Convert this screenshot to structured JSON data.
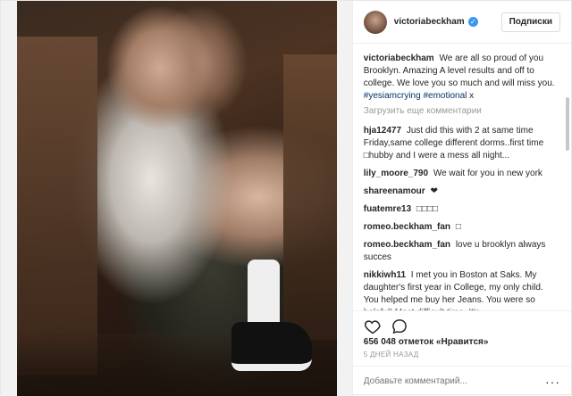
{
  "post": {
    "username": "victoriabeckham",
    "follow_label": "Подписки",
    "caption_user": "victoriabeckham",
    "caption_text": "We are all so proud of you Brooklyn. Amazing A level results and off to college. We love you so much and will miss you.",
    "caption_tags": [
      "#yesiamcrying",
      "#emotional"
    ],
    "caption_tail": "x",
    "load_more": "Загрузить еще комментарии",
    "likes": "656 048 отметок «Нравится»",
    "time": "5 ДНЕЙ НАЗАД",
    "add_comment_placeholder": "Добавьте комментарий...",
    "more_icon": "···"
  },
  "comments": [
    {
      "user": "hja12477",
      "text": "Just did this with 2 at same time Friday,same college different dorms..first time □hubby and I were a mess all night..."
    },
    {
      "user": "lily_moore_790",
      "text": "We wait for you in new york"
    },
    {
      "user": "shareenamour",
      "text": "❤"
    },
    {
      "user": "fuatemre13",
      "text": "□□□□"
    },
    {
      "user": "romeo.beckham_fan",
      "text": "□"
    },
    {
      "user": "romeo.beckham_fan",
      "text": "love u brooklyn always succes"
    },
    {
      "user": "nikkiwh11",
      "text": "I met you in Boston at Saks. My daughter's first year in College, my only child. You helped me buy her Jeans. You were so helpful! Most difficult time. It's..."
    }
  ],
  "colors": {
    "verified": "#3897f0",
    "link": "#003569",
    "muted": "#999999"
  },
  "icons": {
    "like": "heart-icon",
    "comment": "comment-icon",
    "verified": "verified-badge-icon",
    "more": "more-options-icon"
  }
}
